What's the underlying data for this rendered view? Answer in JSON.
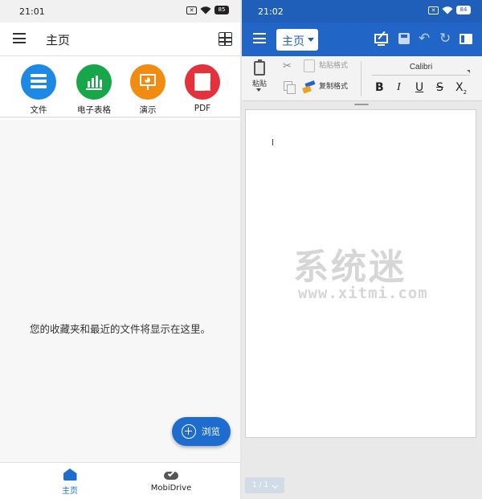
{
  "left": {
    "status": {
      "time": "21:01",
      "battery": "85"
    },
    "appbar": {
      "title": "主页"
    },
    "tiles": [
      {
        "label": "文件",
        "color": "#1e88e5",
        "icon": "document-icon"
      },
      {
        "label": "电子表格",
        "color": "#17a64a",
        "icon": "spreadsheet-icon"
      },
      {
        "label": "演示",
        "color": "#f18b12",
        "icon": "presentation-icon"
      },
      {
        "label": "PDF",
        "color": "#e3323c",
        "icon": "pdf-icon"
      }
    ],
    "empty_message": "您的收藏夹和最近的文件将显示在这里。",
    "fab": {
      "label": "浏览"
    },
    "bottom_nav": {
      "home": "主页",
      "drive": "MobiDrive"
    }
  },
  "right": {
    "status": {
      "time": "21:02",
      "battery": "84"
    },
    "appbar": {
      "tab": "主页"
    },
    "ribbon": {
      "paste": "粘贴",
      "paste_format": "粘贴格式",
      "copy_format": "复制格式",
      "font": "Calibri",
      "bold": "B",
      "italic": "I",
      "underline": "U",
      "strike": "S",
      "subscript": "X"
    },
    "page_indicator": "1 / 1"
  },
  "watermark": {
    "title": "系统迷",
    "url": "www.xitmi.com"
  },
  "colors": {
    "accent": "#1f6ccf",
    "toolbar": "#2165c6",
    "statusbar": "#1f5fba"
  }
}
